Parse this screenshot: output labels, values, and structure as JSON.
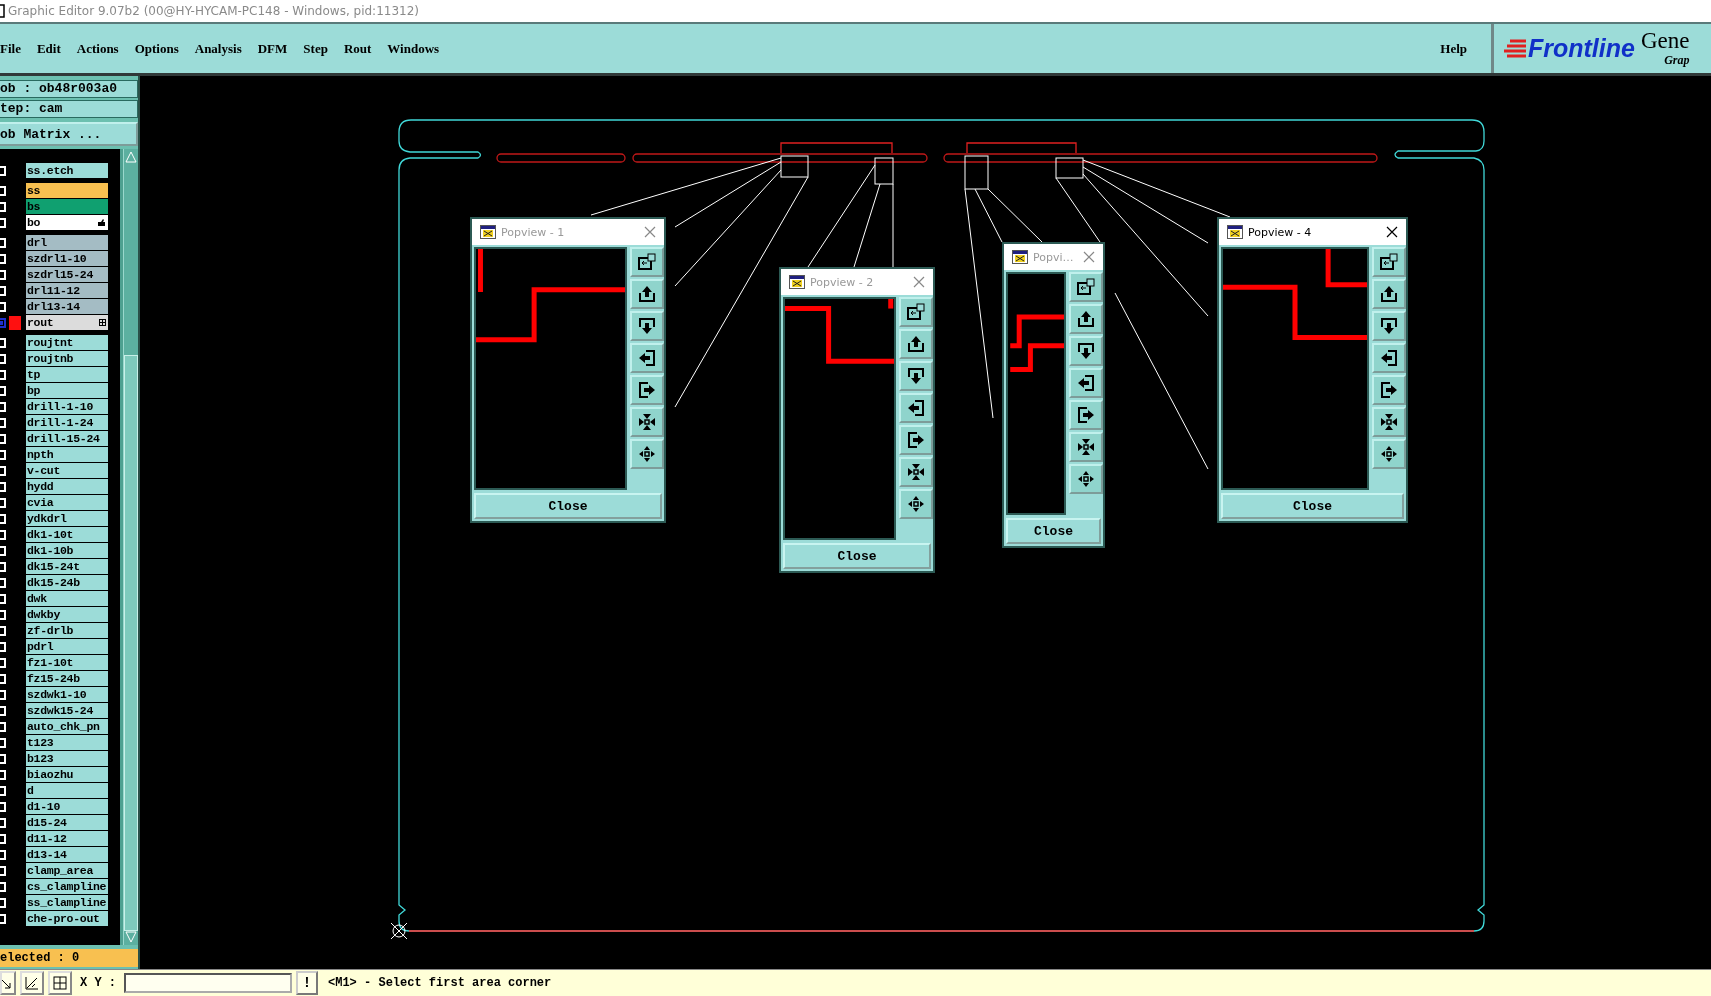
{
  "window": {
    "title": "Graphic Editor 9.07b2 (00@HY-HYCAM-PC148 - Windows, pid:11312)"
  },
  "menu": [
    "File",
    "Edit",
    "Actions",
    "Options",
    "Analysis",
    "DFM",
    "Step",
    "Rout",
    "Windows"
  ],
  "help_menu": "Help",
  "logo": {
    "brand": "Frontline",
    "title": "Gene",
    "subtitle": "Grap"
  },
  "job_panel": {
    "job": "ob : ob48r003a0",
    "step": "tep: cam",
    "matrix_button": "ob Matrix ..."
  },
  "layer_groups": [
    {
      "layers": [
        {
          "name": "ss.etch",
          "color": "#9cdcd8",
          "selected": false
        }
      ]
    },
    {
      "layers": [
        {
          "name": "ss",
          "color": "#f8c050",
          "selected": false
        },
        {
          "name": "bs",
          "color": "#10a070",
          "selected": false
        },
        {
          "name": "bo",
          "color": "#ffffff",
          "selected": false,
          "kind": "hand"
        }
      ]
    },
    {
      "layers": [
        {
          "name": "drl",
          "color": "#a4bcc4",
          "selected": false
        },
        {
          "name": "szdrl1-10",
          "color": "#a4bcc4",
          "selected": false
        },
        {
          "name": "szdrl15-24",
          "color": "#a4bcc4",
          "selected": false
        },
        {
          "name": "drl11-12",
          "color": "#a4bcc4",
          "selected": false
        },
        {
          "name": "drl13-14",
          "color": "#a4bcc4",
          "selected": false
        },
        {
          "name": "rout",
          "color": "#dcdcdc",
          "selected": true,
          "kind": "grid"
        }
      ]
    },
    {
      "layers": [
        {
          "name": "roujtnt",
          "color": "#9cdcd8",
          "selected": false
        },
        {
          "name": "roujtnb",
          "color": "#9cdcd8",
          "selected": false
        },
        {
          "name": "tp",
          "color": "#9cdcd8",
          "selected": false
        },
        {
          "name": "bp",
          "color": "#9cdcd8",
          "selected": false
        },
        {
          "name": "drill-1-10",
          "color": "#9cdcd8",
          "selected": false
        },
        {
          "name": "drill-1-24",
          "color": "#9cdcd8",
          "selected": false
        },
        {
          "name": "drill-15-24",
          "color": "#9cdcd8",
          "selected": false
        },
        {
          "name": "npth",
          "color": "#9cdcd8",
          "selected": false
        },
        {
          "name": "v-cut",
          "color": "#9cdcd8",
          "selected": false
        },
        {
          "name": "hydd",
          "color": "#9cdcd8",
          "selected": false
        },
        {
          "name": "cvia",
          "color": "#9cdcd8",
          "selected": false
        },
        {
          "name": "ydkdrl",
          "color": "#9cdcd8",
          "selected": false
        },
        {
          "name": "dk1-10t",
          "color": "#9cdcd8",
          "selected": false
        },
        {
          "name": "dk1-10b",
          "color": "#9cdcd8",
          "selected": false
        },
        {
          "name": "dk15-24t",
          "color": "#9cdcd8",
          "selected": false
        },
        {
          "name": "dk15-24b",
          "color": "#9cdcd8",
          "selected": false
        },
        {
          "name": "dwk",
          "color": "#9cdcd8",
          "selected": false
        },
        {
          "name": "dwkby",
          "color": "#9cdcd8",
          "selected": false
        },
        {
          "name": "zf-drlb",
          "color": "#9cdcd8",
          "selected": false
        },
        {
          "name": "pdrl",
          "color": "#9cdcd8",
          "selected": false
        },
        {
          "name": "fz1-10t",
          "color": "#9cdcd8",
          "selected": false
        },
        {
          "name": "fz15-24b",
          "color": "#9cdcd8",
          "selected": false
        },
        {
          "name": "szdwk1-10",
          "color": "#9cdcd8",
          "selected": false
        },
        {
          "name": "szdwk15-24",
          "color": "#9cdcd8",
          "selected": false
        },
        {
          "name": "auto_chk_pn",
          "color": "#9cdcd8",
          "selected": false
        },
        {
          "name": "t123",
          "color": "#9cdcd8",
          "selected": false
        },
        {
          "name": "b123",
          "color": "#9cdcd8",
          "selected": false
        },
        {
          "name": "biaozhu",
          "color": "#9cdcd8",
          "selected": false
        },
        {
          "name": "d",
          "color": "#9cdcd8",
          "selected": false
        },
        {
          "name": "d1-10",
          "color": "#9cdcd8",
          "selected": false
        },
        {
          "name": "d15-24",
          "color": "#9cdcd8",
          "selected": false
        },
        {
          "name": "d11-12",
          "color": "#9cdcd8",
          "selected": false
        },
        {
          "name": "d13-14",
          "color": "#9cdcd8",
          "selected": false
        },
        {
          "name": "clamp_area",
          "color": "#9cdcd8",
          "selected": false
        },
        {
          "name": "cs_clampline",
          "color": "#9cdcd8",
          "selected": false
        },
        {
          "name": "ss_clampline",
          "color": "#9cdcd8",
          "selected": false
        },
        {
          "name": "che-pro-out",
          "color": "#9cdcd8",
          "selected": false
        }
      ]
    }
  ],
  "selection_count": "elected : 0",
  "popviews": [
    {
      "title": "Popview - 1",
      "active": false,
      "close_button": "Close"
    },
    {
      "title": "Popview - 2",
      "active": false,
      "close_button": "Close"
    },
    {
      "title": "Popvi…",
      "active": false,
      "close_button": "Close"
    },
    {
      "title": "Popview - 4",
      "active": true,
      "close_button": "Close"
    }
  ],
  "status_bar": {
    "coordinate_label": "X Y :",
    "alert_button": "!",
    "message": "<M1> - Select first area corner"
  }
}
